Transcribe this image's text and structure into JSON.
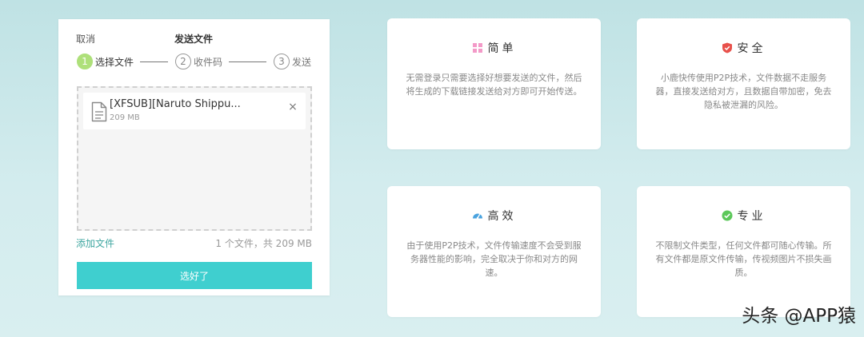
{
  "panel": {
    "cancel_label": "取消",
    "title": "发送文件",
    "steps": [
      {
        "num": "1",
        "label": "选择文件"
      },
      {
        "num": "2",
        "label": "收件码"
      },
      {
        "num": "3",
        "label": "发送"
      }
    ],
    "file": {
      "name": "[XFSUB][Naruto Shippu...",
      "size": "209 MB",
      "close_glyph": "×"
    },
    "add_file_label": "添加文件",
    "file_count": "1 个文件，共 209 MB",
    "confirm_label": "选好了",
    "accent_color": "#3fcfcf"
  },
  "features": [
    {
      "icon": "grid-icon",
      "icon_color": "#f39ac8",
      "title": "简单",
      "desc": "无需登录只需要选择好想要发送的文件，然后将生成的下载链接发送给对方即可开始传送。"
    },
    {
      "icon": "shield-icon",
      "icon_color": "#e8514b",
      "title": "安全",
      "desc": "小鹿快传使用P2P技术，文件数据不走服务器，直接发送给对方，且数据自带加密，免去隐私被泄漏的风险。"
    },
    {
      "icon": "speedometer-icon",
      "icon_color": "#4aa3df",
      "title": "高效",
      "desc": "由于使用P2P技术，文件传输速度不会受到服务器性能的影响，完全取决于你和对方的网速。"
    },
    {
      "icon": "check-circle-icon",
      "icon_color": "#5cc85a",
      "title": "专业",
      "desc": "不限制文件类型，任何文件都可随心传输。所有文件都是原文件传输，传视频图片不损失画质。"
    }
  ],
  "watermark": "头条 @APP猿"
}
